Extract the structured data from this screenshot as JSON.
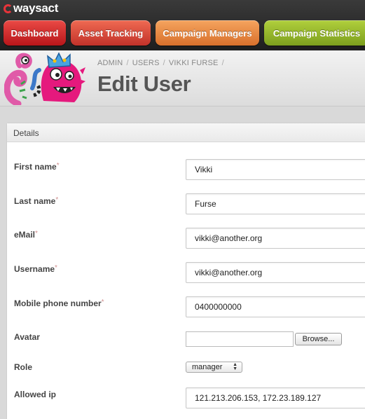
{
  "app": {
    "logo_text": "waysact"
  },
  "nav": {
    "items": [
      {
        "label": "Dashboard",
        "color": "#d42a2a"
      },
      {
        "label": "Asset Tracking",
        "color": "#d9473c"
      },
      {
        "label": "Campaign Managers",
        "color": "#e78a45"
      },
      {
        "label": "Campaign Statistics",
        "color": "#96b82c"
      }
    ]
  },
  "header": {
    "breadcrumb": [
      "ADMIN",
      "USERS",
      "VIKKI FURSE"
    ],
    "breadcrumb_sep": "/",
    "title": "Edit User"
  },
  "panel": {
    "title": "Details",
    "required_marker": "*",
    "fields": {
      "first_name": {
        "label": "First name",
        "value": "Vikki"
      },
      "last_name": {
        "label": "Last name",
        "value": "Furse"
      },
      "email": {
        "label": "eMail",
        "value": "vikki@another.org"
      },
      "username": {
        "label": "Username",
        "value": "vikki@another.org"
      },
      "mobile": {
        "label": "Mobile phone number",
        "value": "0400000000"
      },
      "avatar": {
        "label": "Avatar",
        "button": "Browse..."
      },
      "role": {
        "label": "Role",
        "value": "manager"
      },
      "allowed_ip": {
        "label": "Allowed ip",
        "value": "121.213.206.153, 172.23.189.127"
      }
    }
  }
}
